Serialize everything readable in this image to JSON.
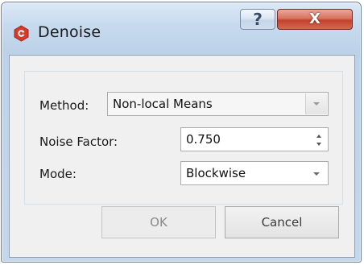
{
  "window": {
    "title": "Denoise",
    "app_icon": "app-logo-icon",
    "help_glyph": "?",
    "close_glyph": "X"
  },
  "form": {
    "method_label": "Method:",
    "method_value": "Non-local Means",
    "noise_factor_label": "Noise Factor:",
    "noise_factor_value": "0.750",
    "mode_label": "Mode:",
    "mode_value": "Blockwise"
  },
  "buttons": {
    "ok": "OK",
    "cancel": "Cancel"
  },
  "colors": {
    "app_icon": "#d63a2a",
    "close_button": "#c8452f"
  }
}
